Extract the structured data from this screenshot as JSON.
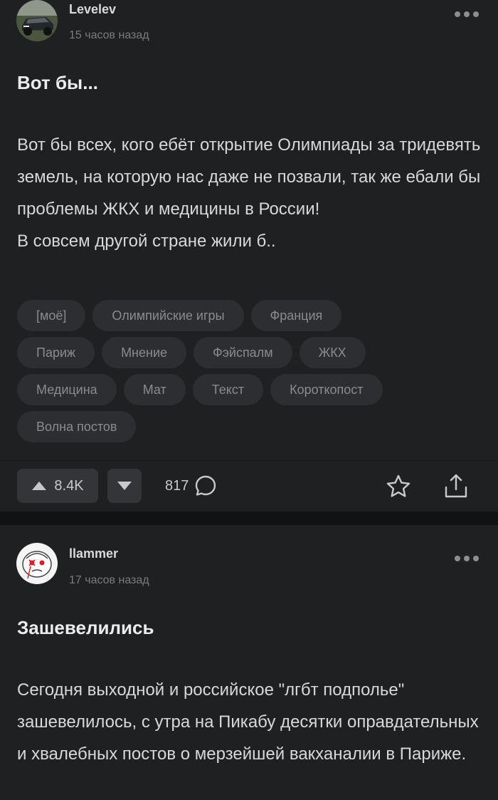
{
  "posts": [
    {
      "author": "Levelev",
      "time": "15 часов назад",
      "title": "Вот бы...",
      "body": [
        "Вот бы всех, кого ебёт открытие Олимпиады за тридевять земель, на которую нас даже не позвали, так же ебали бы проблемы ЖКХ и медицины в России!",
        "В совсем другой стране жили б.."
      ],
      "tags": [
        "[моё]",
        "Олимпийские игры",
        "Франция",
        "Париж",
        "Мнение",
        "Фэйспалм",
        "ЖКХ",
        "Медицина",
        "Мат",
        "Текст",
        "Короткопост",
        "Волна постов"
      ],
      "rating": "8.4K",
      "comments": "817",
      "icons": [
        "avatar-car",
        "more-icon",
        "arrow-up-icon",
        "arrow-down-icon",
        "comment-bubble-icon",
        "star-icon",
        "share-icon"
      ]
    },
    {
      "author": "llammer",
      "time": "17 часов назад",
      "title": "Зашевелились",
      "body": [
        "Сегодня выходной и российское \"лгбт подполье\" зашевелилось, с утра на Пикабу десятки оправдательных и хвалебных постов о мерзейшей вакханалии в Париже."
      ],
      "icons": [
        "avatar-cartoon-face",
        "more-icon"
      ]
    }
  ],
  "colors": {
    "background": "#101112",
    "card": "#1f2022",
    "tag_bg": "#2d2e31",
    "button_bg": "#343538",
    "muted_text": "#7a7b7e"
  }
}
